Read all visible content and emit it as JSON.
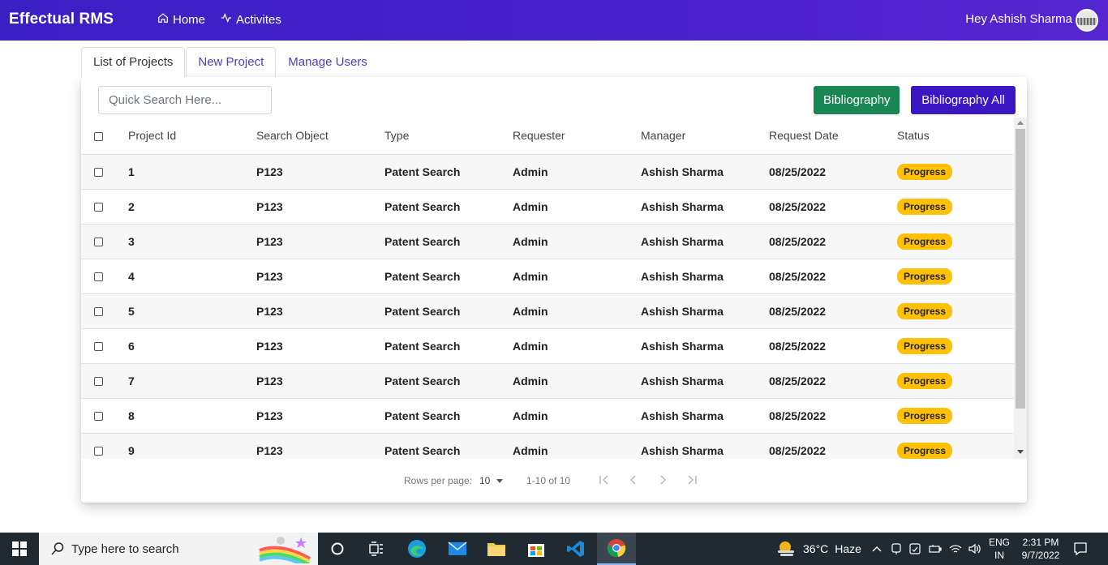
{
  "nav": {
    "brand": "Effectual RMS",
    "home": "Home",
    "activities": "Activites",
    "greeting": "Hey Ashish Sharma"
  },
  "tabs": [
    {
      "label": "List of Projects",
      "active": true
    },
    {
      "label": "New Project",
      "active": false
    },
    {
      "label": "Manage Users",
      "active": false
    }
  ],
  "toolbar": {
    "search_placeholder": "Quick Search Here...",
    "bibliography": "Bibliography",
    "bibliography_all": "Bibliography All"
  },
  "table": {
    "columns": [
      "Project Id",
      "Search Object",
      "Type",
      "Requester",
      "Manager",
      "Request Date",
      "Status"
    ],
    "rows": [
      {
        "id": "1",
        "object": "P123",
        "type": "Patent Search",
        "requester": "Admin",
        "manager": "Ashish Sharma",
        "date": "08/25/2022",
        "status": "Progress"
      },
      {
        "id": "2",
        "object": "P123",
        "type": "Patent Search",
        "requester": "Admin",
        "manager": "Ashish Sharma",
        "date": "08/25/2022",
        "status": "Progress"
      },
      {
        "id": "3",
        "object": "P123",
        "type": "Patent Search",
        "requester": "Admin",
        "manager": "Ashish Sharma",
        "date": "08/25/2022",
        "status": "Progress"
      },
      {
        "id": "4",
        "object": "P123",
        "type": "Patent Search",
        "requester": "Admin",
        "manager": "Ashish Sharma",
        "date": "08/25/2022",
        "status": "Progress"
      },
      {
        "id": "5",
        "object": "P123",
        "type": "Patent Search",
        "requester": "Admin",
        "manager": "Ashish Sharma",
        "date": "08/25/2022",
        "status": "Progress"
      },
      {
        "id": "6",
        "object": "P123",
        "type": "Patent Search",
        "requester": "Admin",
        "manager": "Ashish Sharma",
        "date": "08/25/2022",
        "status": "Progress"
      },
      {
        "id": "7",
        "object": "P123",
        "type": "Patent Search",
        "requester": "Admin",
        "manager": "Ashish Sharma",
        "date": "08/25/2022",
        "status": "Progress"
      },
      {
        "id": "8",
        "object": "P123",
        "type": "Patent Search",
        "requester": "Admin",
        "manager": "Ashish Sharma",
        "date": "08/25/2022",
        "status": "Progress"
      },
      {
        "id": "9",
        "object": "P123",
        "type": "Patent Search",
        "requester": "Admin",
        "manager": "Ashish Sharma",
        "date": "08/25/2022",
        "status": "Progress"
      }
    ]
  },
  "pagination": {
    "rows_per_page_label": "Rows per page:",
    "rows_per_page": "10",
    "range": "1-10 of 10"
  },
  "taskbar": {
    "search_placeholder": "Type here to search",
    "weather_temp": "36°C",
    "weather_desc": "Haze",
    "lang_top": "ENG",
    "lang_bottom": "IN",
    "time": "2:31 PM",
    "date": "9/7/2022"
  },
  "colors": {
    "navbar": "#4a22cc",
    "bibliography_btn": "#198754",
    "bibliography_all_btn": "#3a17c2",
    "status_badge": "#ffc107"
  }
}
